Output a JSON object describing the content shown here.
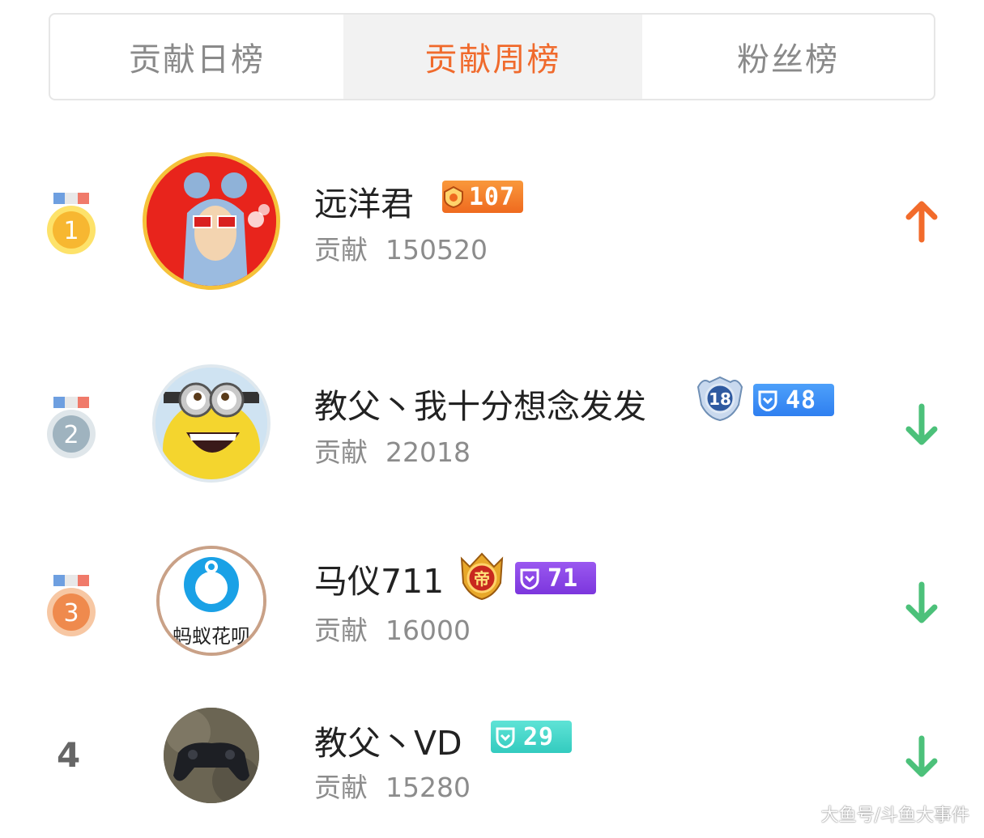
{
  "tabs": [
    {
      "label": "贡献日榜",
      "active": false
    },
    {
      "label": "贡献周榜",
      "active": true
    },
    {
      "label": "粉丝榜",
      "active": false
    }
  ],
  "contribution_label": "贡献",
  "entries": [
    {
      "rank": "1",
      "name": "远洋君",
      "contribution": "150520",
      "level": "107",
      "trend": "up"
    },
    {
      "rank": "2",
      "name": "教父丶我十分想念发发",
      "contribution": "22018",
      "noble_badge": "18",
      "level": "48",
      "trend": "down"
    },
    {
      "rank": "3",
      "name": "马仪711",
      "contribution": "16000",
      "noble_badge": "帝",
      "avatar_text": "蚂蚁花呗",
      "level": "71",
      "trend": "down"
    },
    {
      "rank": "4",
      "name": "教父丶VD",
      "contribution": "15280",
      "level": "29",
      "trend": "down"
    }
  ],
  "watermark": "大鱼号/斗鱼大事件",
  "colors": {
    "accent": "#f06a2c",
    "up": "#f26b2b",
    "down": "#4cc17a",
    "gold": "#f7b731",
    "silver": "#9fb3bf",
    "bronze": "#ef8a4d",
    "badge_orange": "#f57d2a",
    "badge_blue": "#3d8ef5",
    "badge_purple": "#8a45e6",
    "badge_teal": "#3fd3c7"
  }
}
